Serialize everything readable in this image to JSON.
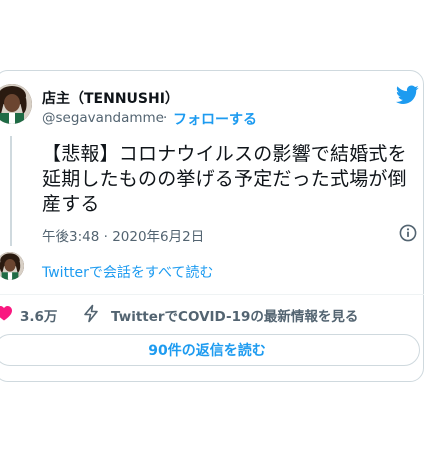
{
  "tweet": {
    "author_name": "店主（TENNUSHI）",
    "handle": "@segavandamme",
    "separator": "·",
    "follow_label": "フォローする",
    "text": "【悲報】コロナウイルスの影響で結婚式を延期したものの挙げる予定だった式場が倒産する",
    "timestamp": "午後3:48 · 2020年6月2日",
    "conversation_link": "Twitterで会話をすべて読む",
    "like_count": "3.6万",
    "covid_link": "TwitterでCOVID-19の最新情報を見る",
    "replies_button": "90件の返信を読む"
  },
  "colors": {
    "accent": "#1d9bf0",
    "like_red": "#f91880",
    "secondary_text": "#536471",
    "border": "#cfd9de"
  },
  "icons": [
    "twitter-bird-icon",
    "info-icon",
    "heart-icon",
    "bolt-icon"
  ]
}
